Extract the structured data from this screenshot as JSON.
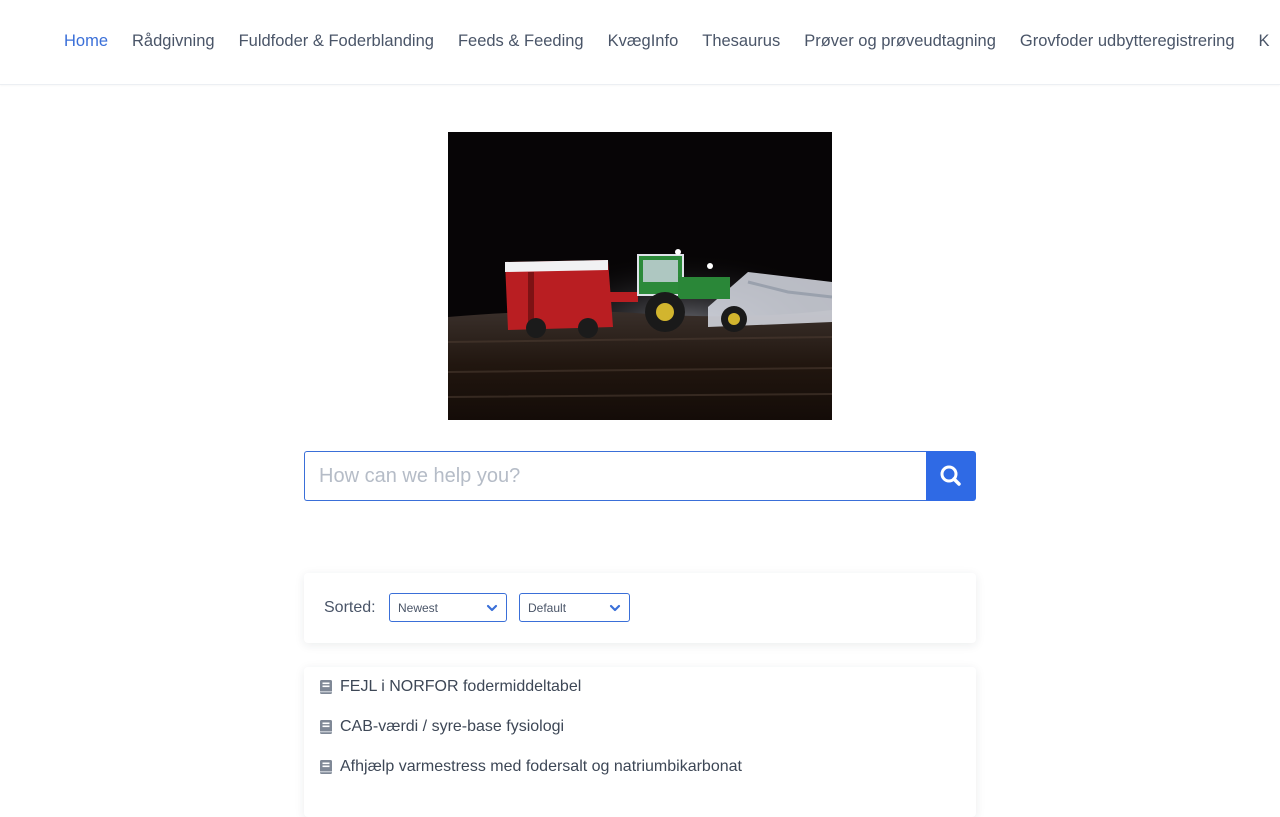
{
  "nav": {
    "items": [
      {
        "label": "Home",
        "active": true
      },
      {
        "label": "Rådgivning"
      },
      {
        "label": "Fuldfoder & Foderblanding"
      },
      {
        "label": "Feeds & Feeding"
      },
      {
        "label": "KvægInfo"
      },
      {
        "label": "Thesaurus"
      },
      {
        "label": "Prøver og prøveudtagning"
      },
      {
        "label": "Grovfoder udbytteregistrering"
      },
      {
        "label": "K"
      }
    ]
  },
  "search": {
    "placeholder": "How can we help you?",
    "icon": "search-icon"
  },
  "sort": {
    "label": "Sorted:",
    "order_value": "Newest",
    "view_value": "Default"
  },
  "articles": [
    {
      "title": "FEJL i NORFOR fodermiddeltabel",
      "icon": "book-icon"
    },
    {
      "title": "CAB-værdi / syre-base fysiologi",
      "icon": "book-icon"
    },
    {
      "title": "Afhjælp varmestress med fodersalt og natriumbikarbonat",
      "icon": "book-icon"
    }
  ],
  "colors": {
    "accent": "#2f6ae5",
    "nav_active": "#3a6fd8",
    "text": "#3d4756"
  }
}
